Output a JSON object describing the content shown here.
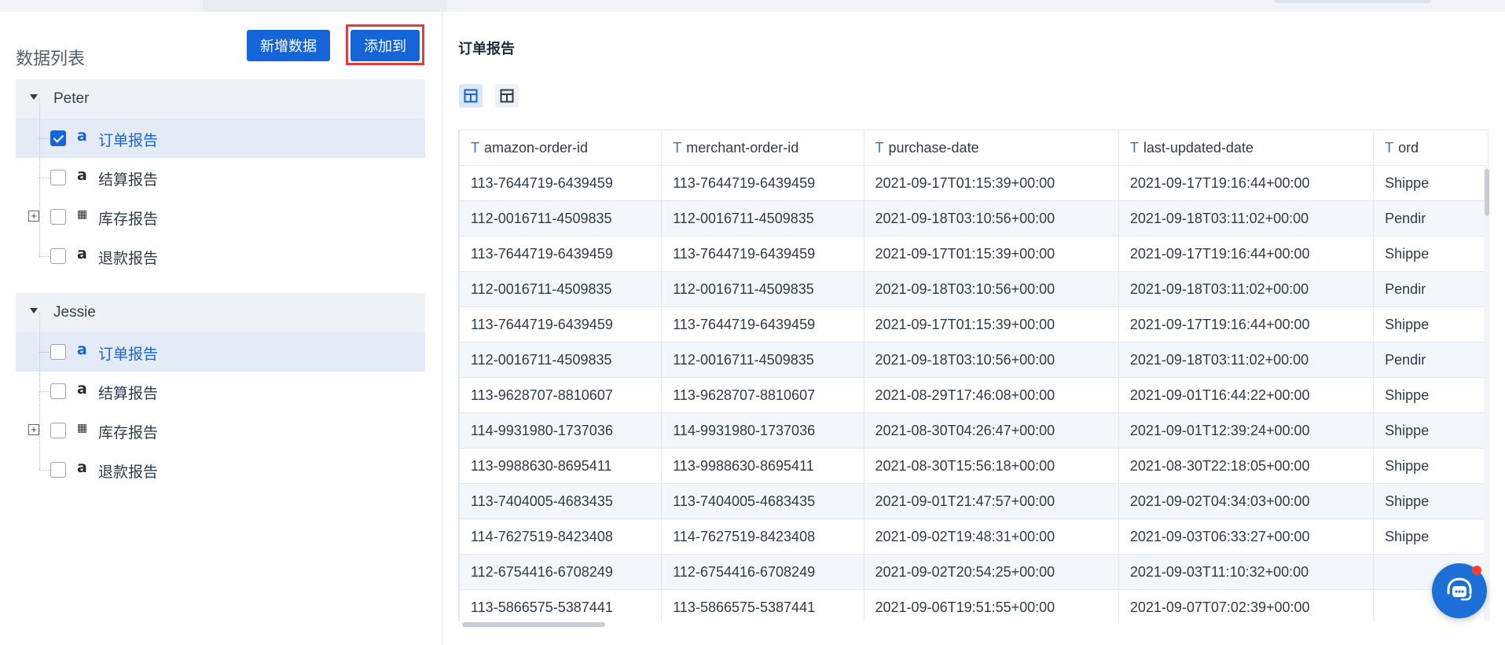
{
  "left_panel": {
    "title": "数据列表",
    "new_data_label": "新增数据",
    "add_to_label": "添加到",
    "groups": [
      {
        "name": "Peter",
        "items": [
          {
            "label": "订单报告",
            "icon": "amazon-icon",
            "checked": true
          },
          {
            "label": "结算报告",
            "icon": "amazon-icon",
            "checked": false
          },
          {
            "label": "库存报告",
            "icon": "grid-icon",
            "checked": false,
            "expandable": true
          },
          {
            "label": "退款报告",
            "icon": "amazon-icon",
            "checked": false
          }
        ]
      },
      {
        "name": "Jessie",
        "items": [
          {
            "label": "订单报告",
            "icon": "amazon-icon",
            "checked": false
          },
          {
            "label": "结算报告",
            "icon": "amazon-icon",
            "checked": false
          },
          {
            "label": "库存报告",
            "icon": "grid-icon",
            "checked": false,
            "expandable": true
          },
          {
            "label": "退款报告",
            "icon": "amazon-icon",
            "checked": false
          }
        ]
      }
    ]
  },
  "right_panel": {
    "title": "订单报告",
    "view_buttons": [
      "table-view-icon",
      "layout-view-icon"
    ],
    "table": {
      "columns": [
        "amazon-order-id",
        "merchant-order-id",
        "purchase-date",
        "last-updated-date",
        "ord"
      ],
      "rows": [
        [
          "113-7644719-6439459",
          "113-7644719-6439459",
          "2021-09-17T01:15:39+00:00",
          "2021-09-17T19:16:44+00:00",
          "Shippe"
        ],
        [
          "112-0016711-4509835",
          "112-0016711-4509835",
          "2021-09-18T03:10:56+00:00",
          "2021-09-18T03:11:02+00:00",
          "Pendir"
        ],
        [
          "113-7644719-6439459",
          "113-7644719-6439459",
          "2021-09-17T01:15:39+00:00",
          "2021-09-17T19:16:44+00:00",
          "Shippe"
        ],
        [
          "112-0016711-4509835",
          "112-0016711-4509835",
          "2021-09-18T03:10:56+00:00",
          "2021-09-18T03:11:02+00:00",
          "Pendir"
        ],
        [
          "113-7644719-6439459",
          "113-7644719-6439459",
          "2021-09-17T01:15:39+00:00",
          "2021-09-17T19:16:44+00:00",
          "Shippe"
        ],
        [
          "112-0016711-4509835",
          "112-0016711-4509835",
          "2021-09-18T03:10:56+00:00",
          "2021-09-18T03:11:02+00:00",
          "Pendir"
        ],
        [
          "113-9628707-8810607",
          "113-9628707-8810607",
          "2021-08-29T17:46:08+00:00",
          "2021-09-01T16:44:22+00:00",
          "Shippe"
        ],
        [
          "114-9931980-1737036",
          "114-9931980-1737036",
          "2021-08-30T04:26:47+00:00",
          "2021-09-01T12:39:24+00:00",
          "Shippe"
        ],
        [
          "113-9988630-8695411",
          "113-9988630-8695411",
          "2021-08-30T15:56:18+00:00",
          "2021-08-30T22:18:05+00:00",
          "Shippe"
        ],
        [
          "113-7404005-4683435",
          "113-7404005-4683435",
          "2021-09-01T21:47:57+00:00",
          "2021-09-02T04:34:03+00:00",
          "Shippe"
        ],
        [
          "114-7627519-8423408",
          "114-7627519-8423408",
          "2021-09-02T19:48:31+00:00",
          "2021-09-03T06:33:27+00:00",
          "Shippe"
        ],
        [
          "112-6754416-6708249",
          "112-6754416-6708249",
          "2021-09-02T20:54:25+00:00",
          "2021-09-03T11:10:32+00:00",
          ""
        ],
        [
          "113-5866575-5387441",
          "113-5866575-5387441",
          "2021-09-06T19:51:55+00:00",
          "2021-09-07T07:02:39+00:00",
          ""
        ]
      ]
    }
  },
  "colors": {
    "primary": "#1565d8",
    "highlight_frame": "#e23b3b",
    "selected_row": "#e4ebf7",
    "group_header": "#eef1f6"
  }
}
